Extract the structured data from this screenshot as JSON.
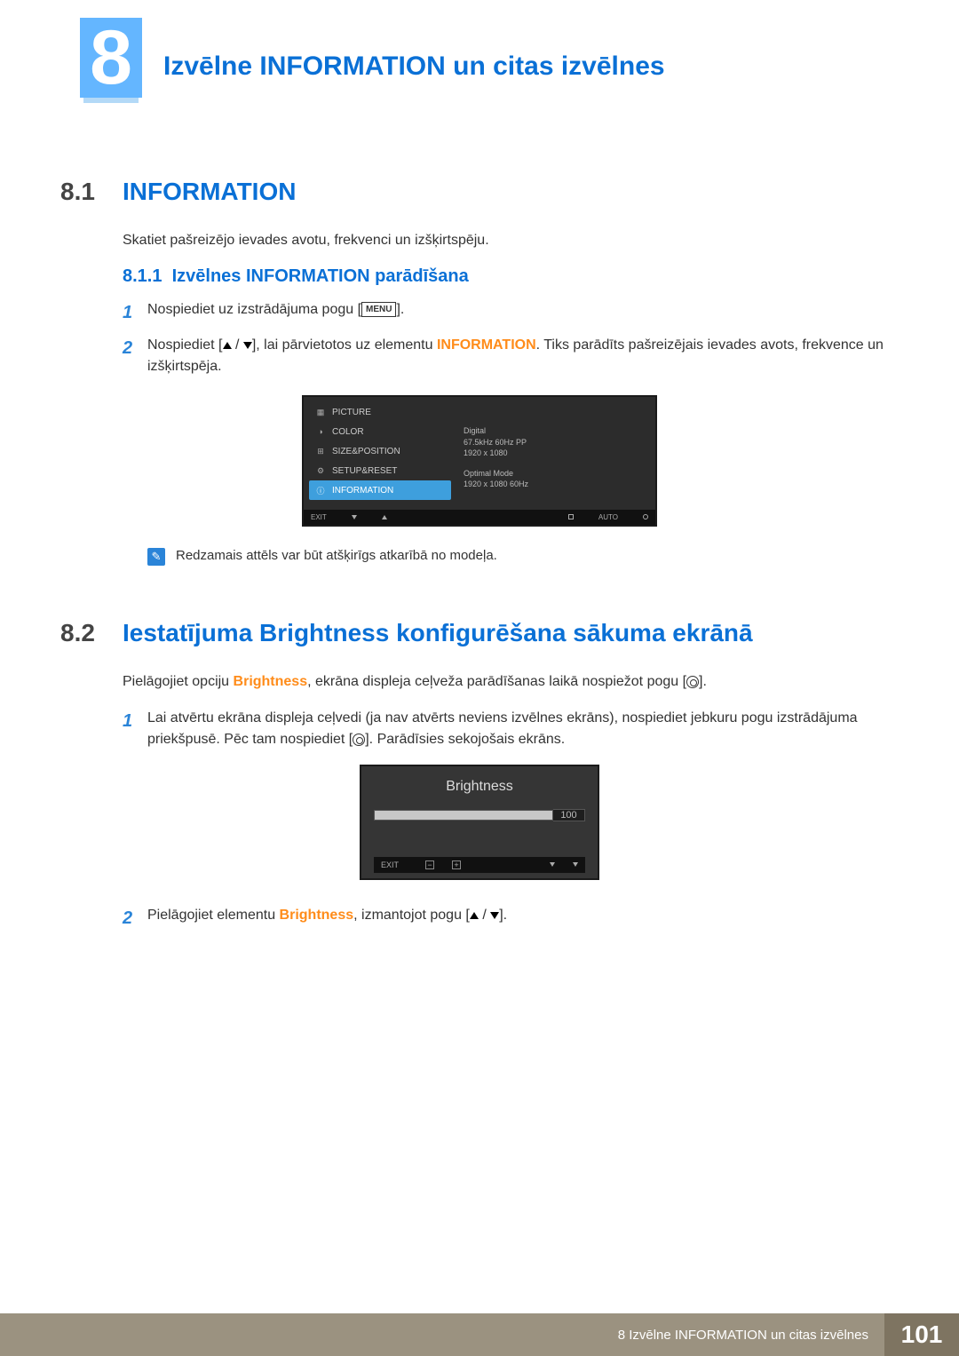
{
  "chapter": {
    "number": "8",
    "title": "Izvēlne INFORMATION un citas izvēlnes"
  },
  "section_8_1": {
    "num": "8.1",
    "title": "INFORMATION",
    "intro": "Skatiet pašreizējo ievades avotu, frekvenci un izšķirtspēju.",
    "sub": {
      "num": "8.1.1",
      "title": "Izvēlnes INFORMATION parādīšana"
    },
    "steps": {
      "s1_pre": "Nospiediet uz izstrādājuma pogu [",
      "s1_btn": "MENU",
      "s1_post": "].",
      "s2_pre": "Nospiediet [",
      "s2_mid": "], lai pārvietotos uz elementu ",
      "s2_hl": "INFORMATION",
      "s2_post": ". Tiks parādīts pašreizējais ievades avots, frekvence un izšķirtspēja."
    },
    "note": "Redzamais attēls var būt atšķirīgs atkarībā no modeļa."
  },
  "osd": {
    "items": [
      "PICTURE",
      "COLOR",
      "SIZE&POSITION",
      "SETUP&RESET",
      "INFORMATION"
    ],
    "info_lines_a": [
      "Digital",
      "67.5kHz 60Hz PP",
      "1920 x 1080"
    ],
    "info_lines_b": [
      "Optimal Mode",
      "1920 x 1080 60Hz"
    ],
    "foot": {
      "exit": "EXIT",
      "auto": "AUTO"
    }
  },
  "section_8_2": {
    "num": "8.2",
    "title": "Iestatījuma Brightness konfigurēšana sākuma ekrānā",
    "intro_pre": "Pielāgojiet opciju ",
    "intro_hl": "Brightness",
    "intro_mid": ", ekrāna displeja ceļveža parādīšanas laikā nospiežot pogu [",
    "intro_post": "].",
    "step1_pre": "Lai atvērtu ekrāna displeja ceļvedi (ja nav atvērts neviens izvēlnes ekrāns), nospiediet jebkuru pogu izstrādājuma priekšpusē. Pēc tam nospiediet [",
    "step1_post": "]. Parādīsies sekojošais ekrāns.",
    "step2_pre": "Pielāgojiet elementu ",
    "step2_hl": "Brightness",
    "step2_mid": ", izmantojot pogu [",
    "step2_post": "]."
  },
  "brightness_box": {
    "title": "Brightness",
    "value": "100",
    "exit": "EXIT"
  },
  "footer": {
    "text": "8 Izvēlne INFORMATION un citas izvēlnes",
    "page": "101"
  }
}
